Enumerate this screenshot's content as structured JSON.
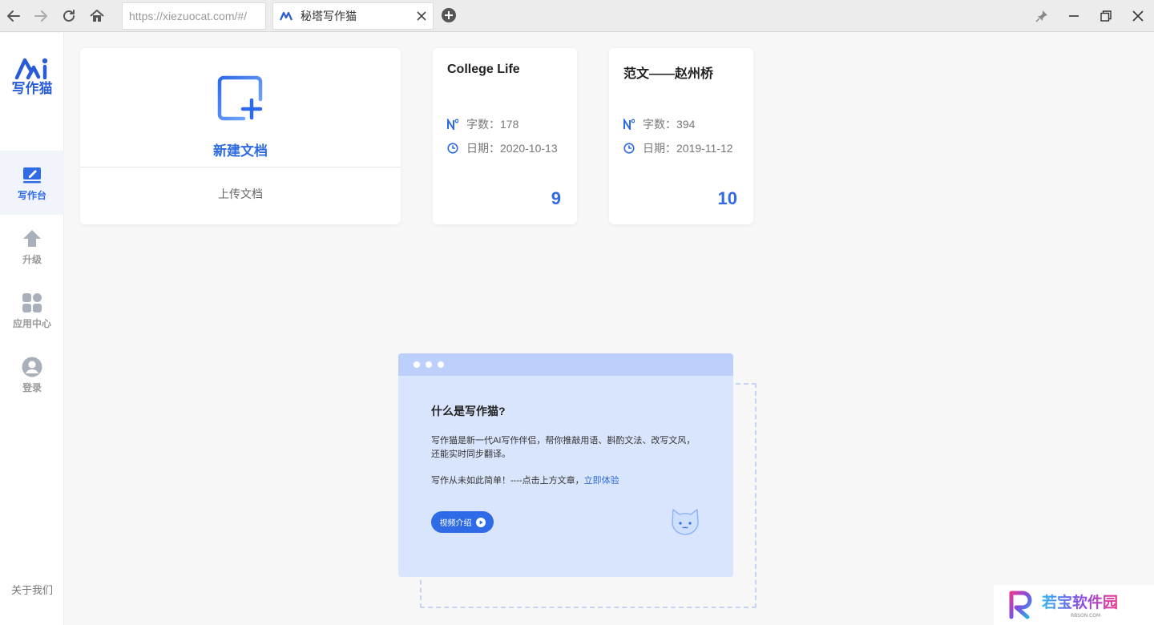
{
  "browser": {
    "url": "https://xiezuocat.com/#/",
    "tab_title": "秘塔写作猫"
  },
  "sidebar": {
    "logo_text": "写作猫",
    "items": [
      {
        "label": "写作台",
        "icon": "edit-desk-icon",
        "active": true
      },
      {
        "label": "升级",
        "icon": "upgrade-arrow-icon",
        "active": false
      },
      {
        "label": "应用中心",
        "icon": "apps-grid-icon",
        "active": false
      },
      {
        "label": "登录",
        "icon": "user-avatar-icon",
        "active": false
      }
    ],
    "about": "关于我们"
  },
  "new_card": {
    "new_label": "新建文档",
    "upload_label": "上传文档"
  },
  "documents": [
    {
      "title": "College Life",
      "words": "字数：178",
      "date": "日期：2020-10-13",
      "count": "9"
    },
    {
      "title": "范文——赵州桥",
      "words": "字数：394",
      "date": "日期：2019-11-12",
      "count": "10"
    }
  ],
  "intro": {
    "title": "什么是写作猫?",
    "line1": "写作猫是新一代AI写作伴侣，帮你推敲用语、斟酌文法、改写文风，",
    "line2": "还能实时同步翻译。",
    "line3": "写作从未如此简单！----点击上方文章，",
    "link": "立即体验",
    "video_button": "视频介绍"
  },
  "watermark": {
    "text": "若宝软件园",
    "subtext": "RBSON.COM"
  },
  "colors": {
    "accent": "#2f6be6",
    "intro_bg": "#d9e5fd",
    "intro_head": "#bdd0fb"
  }
}
